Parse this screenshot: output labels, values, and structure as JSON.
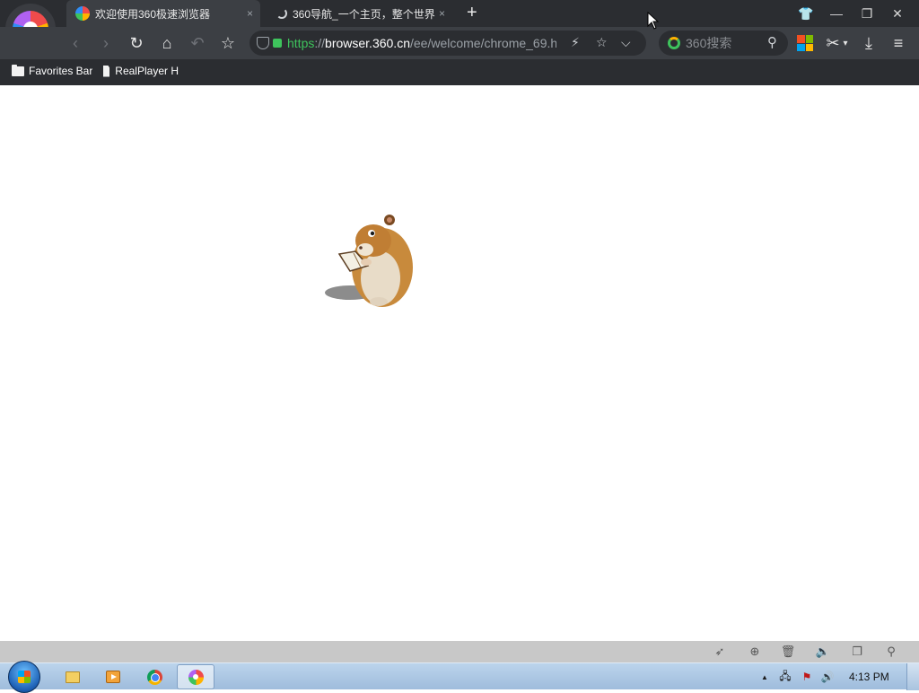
{
  "browser": {
    "tabs": [
      {
        "title": "欢迎使用360极速浏览器",
        "close": "×",
        "active": true
      },
      {
        "title": "360导航_一个主页，整个世界",
        "close": "×",
        "active": false
      }
    ],
    "new_tab_label": "+",
    "window_controls": {
      "skin": "👕",
      "minimize": "—",
      "restore": "❐",
      "close": "✕"
    },
    "nav": {
      "back": "‹",
      "forward": "›",
      "reload": "↻",
      "home": "⌂",
      "undo_close": "↶",
      "favorite": "☆"
    },
    "address": {
      "scheme": "https",
      "separator": "://",
      "host": "browser.360.cn",
      "path": "/ee/welcome/chrome_69.h"
    },
    "address_actions": {
      "speed": "⚡",
      "bookmark_star": "☆",
      "dropdown": "⌵"
    },
    "search": {
      "placeholder": "360搜索",
      "magnifier": "⚲"
    },
    "toolbar_right": {
      "screenshot": "✂",
      "screenshot_menu": "▾",
      "download": "⤓",
      "menu": "≡"
    },
    "bookmarks": [
      {
        "label": "Favorites Bar",
        "icon": "folder-icon"
      },
      {
        "label": "RealPlayer H",
        "icon": "page-icon"
      }
    ],
    "accent_color": "#3ec35c"
  },
  "page": {
    "content_image": "hamster-reading-book"
  },
  "statusbar": {
    "icons": [
      "rocket-icon",
      "speed-icon",
      "trash-icon",
      "volume-icon",
      "window-icon",
      "zoom-icon"
    ],
    "glyphs": {
      "rocket": "➶",
      "speed": "⊕",
      "trash": "🗑",
      "volume": "🔈",
      "window": "❐",
      "zoom": "⚲"
    }
  },
  "taskbar": {
    "items": [
      "explorer",
      "media-player",
      "chrome",
      "360-browser"
    ],
    "tray": {
      "show_hidden": "▲",
      "network": "🖧",
      "action_center": "⚑",
      "volume": "🔊"
    },
    "clock": "4:13 PM"
  }
}
